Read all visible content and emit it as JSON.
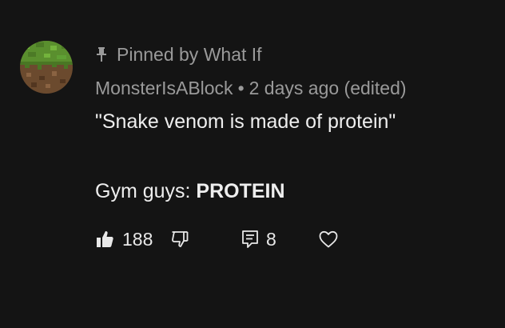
{
  "comment": {
    "pinned_text": "Pinned by What If",
    "author": "MonsterIsABlock",
    "separator": "•",
    "timestamp": "2 days ago (edited)",
    "body_line1": "\"Snake venom is made of protein\"",
    "body_line2_prefix": "Gym guys: ",
    "body_line2_emphasis": "PROTEIN",
    "like_count": "188",
    "reply_count": "8",
    "icons": {
      "pin": "pin-icon",
      "like": "thumbs-up-icon",
      "dislike": "thumbs-down-icon",
      "reply": "reply-icon",
      "heart": "heart-icon"
    }
  }
}
